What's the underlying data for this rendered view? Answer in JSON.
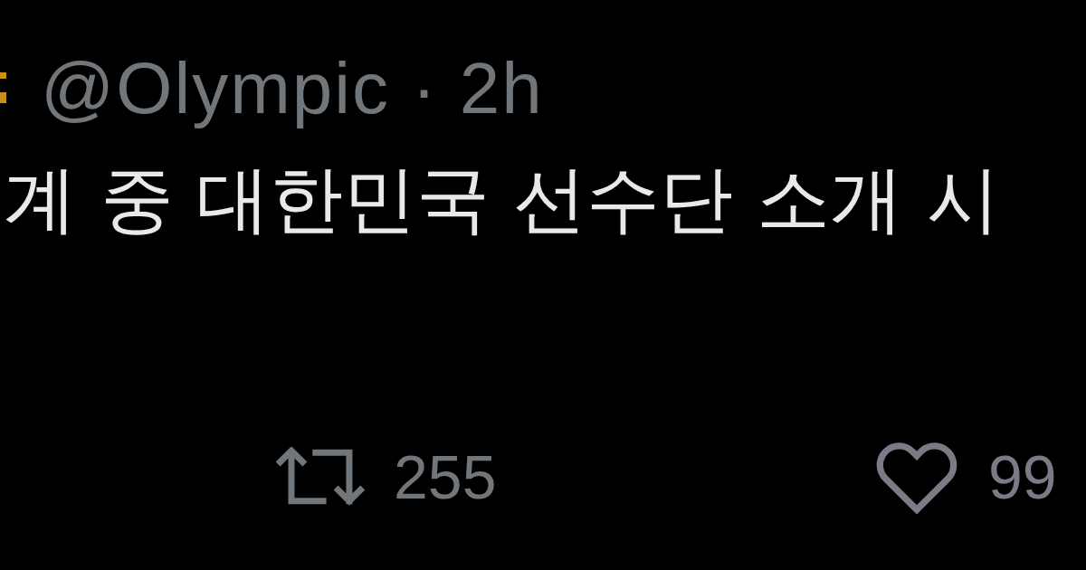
{
  "post": {
    "author": {
      "handle": "@Olympic",
      "separator": "·",
      "time": "2h"
    },
    "text": "계 중 대한민국 선수단 소개 시",
    "actions": [
      {
        "kind": "retweet",
        "count": "255",
        "selected": false
      },
      {
        "kind": "like",
        "count": "99",
        "selected": false
      }
    ]
  }
}
